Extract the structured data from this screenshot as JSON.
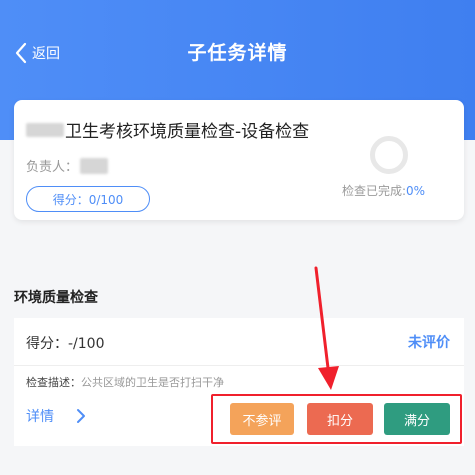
{
  "nav": {
    "back_label": "返回",
    "title": "子任务详情"
  },
  "task": {
    "title": "卫生考核环境质量检查-设备检查",
    "owner_label": "负责人：",
    "score_label": "得分：0/100",
    "progress_label": "检查已完成:",
    "progress_value": "0%"
  },
  "section": {
    "title": "环境质量检查"
  },
  "item": {
    "score_text": "得分：-/100",
    "status": "未评价",
    "desc_label": "检查描述：",
    "desc_value": "公共区域的卫生是否打扫干净",
    "detail_label": "详情",
    "buttons": {
      "not_participate": "不参评",
      "deduct": "扣分",
      "full": "满分"
    }
  },
  "colors": {
    "primary": "#4f8ef7",
    "not_participate": "#f4a35a",
    "deduct": "#ec6a51",
    "full": "#2f9c80",
    "annotation": "#f0202c"
  },
  "icons": {
    "back": "chevron-left-icon",
    "detail": "chevron-right-icon",
    "progress": "progress-ring-icon",
    "annotation": "arrow-annotation"
  }
}
